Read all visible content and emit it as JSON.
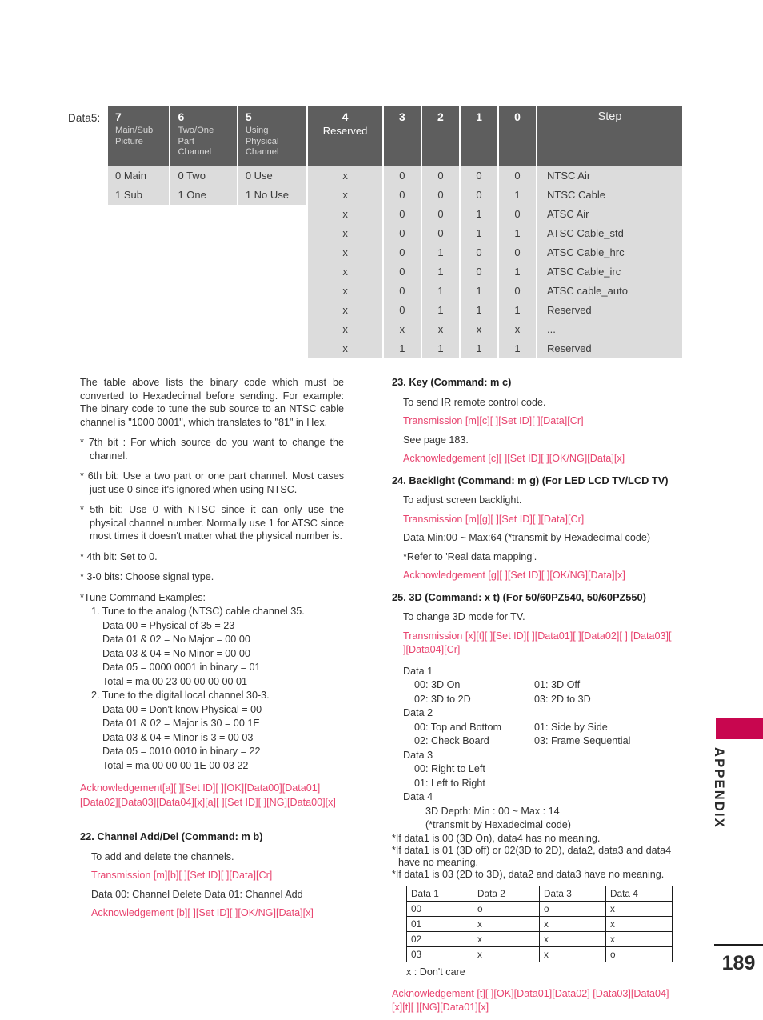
{
  "page": {
    "number": "189",
    "side_tab_label": "APPENDIX"
  },
  "bit_table": {
    "label": "Data5:",
    "headers": [
      {
        "num": "7",
        "sub": "Main/Sub Picture"
      },
      {
        "num": "6",
        "sub": "Two/One Part Channel"
      },
      {
        "num": "5",
        "sub": "Using Physical Channel"
      },
      {
        "num": "4",
        "sub": "Reserved"
      },
      {
        "num": "3",
        "sub": ""
      },
      {
        "num": "2",
        "sub": ""
      },
      {
        "num": "1",
        "sub": ""
      },
      {
        "num": "0",
        "sub": ""
      },
      {
        "num": "",
        "sub": "Step"
      }
    ],
    "left_rows": [
      [
        "0 Main",
        "0 Two",
        "0 Use"
      ],
      [
        "1 Sub",
        "1 One",
        "1 No Use"
      ]
    ],
    "rows": [
      {
        "b4": "x",
        "b3": "0",
        "b2": "0",
        "b1": "0",
        "b0": "0",
        "step": "NTSC Air"
      },
      {
        "b4": "x",
        "b3": "0",
        "b2": "0",
        "b1": "0",
        "b0": "1",
        "step": "NTSC Cable"
      },
      {
        "b4": "x",
        "b3": "0",
        "b2": "0",
        "b1": "1",
        "b0": "0",
        "step": "ATSC Air"
      },
      {
        "b4": "x",
        "b3": "0",
        "b2": "0",
        "b1": "1",
        "b0": "1",
        "step": "ATSC Cable_std"
      },
      {
        "b4": "x",
        "b3": "0",
        "b2": "1",
        "b1": "0",
        "b0": "0",
        "step": "ATSC Cable_hrc"
      },
      {
        "b4": "x",
        "b3": "0",
        "b2": "1",
        "b1": "0",
        "b0": "1",
        "step": "ATSC Cable_irc"
      },
      {
        "b4": "x",
        "b3": "0",
        "b2": "1",
        "b1": "1",
        "b0": "0",
        "step": "ATSC cable_auto"
      },
      {
        "b4": "x",
        "b3": "0",
        "b2": "1",
        "b1": "1",
        "b0": "1",
        "step": "Reserved"
      },
      {
        "b4": "x",
        "b3": "x",
        "b2": "x",
        "b1": "x",
        "b0": "x",
        "step": "..."
      },
      {
        "b4": "x",
        "b3": "1",
        "b2": "1",
        "b1": "1",
        "b0": "1",
        "step": "Reserved"
      }
    ]
  },
  "left_column": {
    "intro": "The table above lists the binary code which must be converted to Hexadecimal before sending. For example: The binary code to tune the sub source to an NTSC cable channel is \"1000 0001\", which translates to \"81\" in Hex.",
    "bit7": "* 7th bit : For which source do you want to change the channel.",
    "bit6": "* 6th bit: Use a two part or one part channel. Most cases just use 0 since it's ignored when using NTSC.",
    "bit5": "* 5th bit: Use 0 with NTSC since it can only use the physical channel number. Normally use 1 for ATSC since most times it doesn't  matter what the physical number is.",
    "bit4": "* 4th bit: Set to 0.",
    "bit3_0": "* 3-0 bits: Choose signal type.",
    "examples_title": "*Tune Command Examples:",
    "example1_title": "1. Tune to the analog (NTSC) cable channel 35.",
    "example1_lines": [
      "Data  00 = Physical of 35 = 23",
      "Data 01 & 02 = No Major = 00 00",
      "Data 03 & 04 = No Minor = 00 00",
      "Data 05 = 0000 0001 in binary = 01",
      "Total = ma 00 23 00 00 00 00 01"
    ],
    "example2_title": "2. Tune to the digital local channel 30-3.",
    "example2_lines": [
      "Data  00 = Don't know Physical = 00",
      "Data 01 & 02 = Major is 30 = 00 1E",
      "Data 03 & 04 = Minor is 3 = 00 03",
      "Data 05 = 0010 0010 in binary = 22",
      "Total = ma 00 00 00 1E 00 03 22"
    ],
    "acknowledgement": "Acknowledgement[a][  ][Set  ID][  ][OK][Data00][Data01] [Data02][Data03][Data04][x][a][ ][Set ID][ ][NG][Data00][x]",
    "section22": {
      "heading": "22. Channel Add/Del (Command: m b)",
      "desc": "To add and delete the channels.",
      "transmission": "Transmission [m][b][  ][Set ID][  ][Data][Cr]",
      "data_note": "Data 00: Channel Delete Data 01: Channel Add",
      "acknowledgement": "Acknowledgement [b][  ][Set ID][  ][OK/NG][Data][x]"
    }
  },
  "right_column": {
    "section23": {
      "heading": "23. Key (Command: m c)",
      "desc": "To send IR remote control code.",
      "transmission": "Transmission [m][c][  ][Set ID][  ][Data][Cr]",
      "see_page": "See page 183.",
      "acknowledgement": "Acknowledgement [c][  ][Set ID][  ][OK/NG][Data][x]"
    },
    "section24": {
      "heading": "24. Backlight (Command: m g) (For LED LCD TV/LCD TV)",
      "desc": "To adjust screen backlight.",
      "transmission": "Transmission [m][g][  ][Set ID][  ][Data][Cr]",
      "data_range": "Data Min:00 ~ Max:64 (*transmit by Hexadecimal code)",
      "refer": "*Refer to 'Real data mapping'.",
      "acknowledgement": "Acknowledgement [g][  ][Set ID][  ][OK/NG][Data][x]"
    },
    "section25": {
      "heading": "25. 3D (Command: x t) (For 50/60PZ540, 50/60PZ550)",
      "desc": "To change 3D mode for TV.",
      "transmission": "Transmission [x][t][  ][Set ID][ ][Data01][ ][Data02][ ] [Data03][ ][Data04][Cr]",
      "data1_label": "Data 1",
      "data1_a1": "00: 3D On",
      "data1_a2": "01: 3D Off",
      "data1_b1": "02: 3D to 2D",
      "data1_b2": "03: 2D to 3D",
      "data2_label": "Data 2",
      "data2_a1": "00: Top and Bottom",
      "data2_a2": "01: Side by Side",
      "data2_b1": "02: Check Board",
      "data2_b2": "03: Frame Sequential",
      "data3_label": "Data 3",
      "data3_a": "00: Right to Left",
      "data3_b": "01: Left to Right",
      "data4_label": "Data 4",
      "data4_a": "3D Depth: Min : 00 ~ Max : 14",
      "data4_b": "(*transmit by Hexadecimal code)",
      "note1": "*If data1 is 00 (3D On), data4 has no meaning.",
      "note2": "*If data1 is 01 (3D off) or 02(3D to 2D), data2, data3 and data4 have no meaning.",
      "note3": "*If data1 is 03 (2D to 3D), data2 and data3 have no meaning.",
      "table": {
        "headers": [
          "Data 1",
          "Data 2",
          "Data 3",
          "Data 4"
        ],
        "rows": [
          [
            "00",
            "o",
            "o",
            "x"
          ],
          [
            "01",
            "x",
            "x",
            "x"
          ],
          [
            "02",
            "x",
            "x",
            "x"
          ],
          [
            "03",
            "x",
            "x",
            "o"
          ]
        ]
      },
      "legend": "x : Don't care",
      "acknowledgement": "Acknowledgement [t][ ][OK][Data01][Data02] [Data03][Data04][x][t][ ][NG][Data01][x]"
    }
  },
  "colors": {
    "accent_pink": "#e8446f",
    "tab_magenta": "#c8064f",
    "table_header": "#5e5e5e",
    "table_body": "#dcdcdc"
  }
}
